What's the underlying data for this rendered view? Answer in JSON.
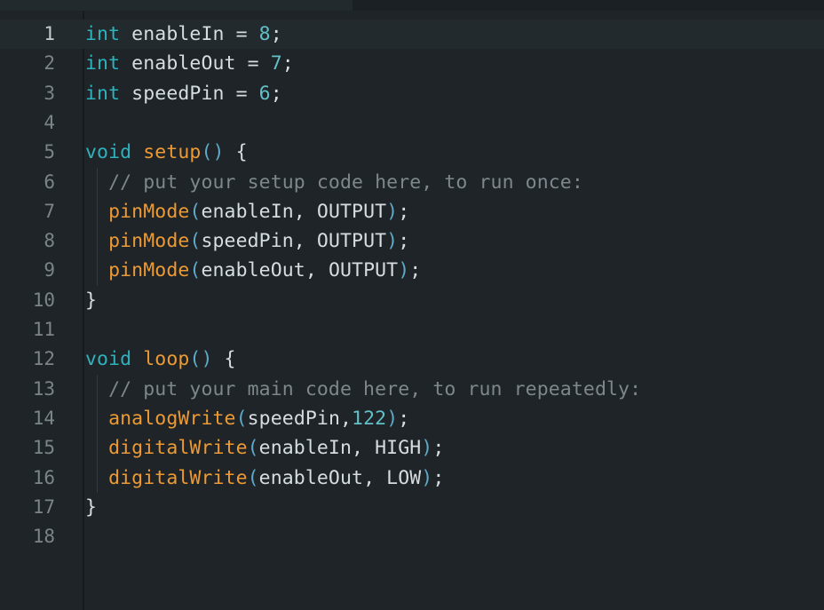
{
  "app": {
    "kind": "code-editor",
    "language": "arduino-c",
    "theme": "dark"
  },
  "colors": {
    "background": "#1e2427",
    "active_line_background": "#232a2d",
    "gutter_separator": "#161b1e",
    "top_strip_left": "#232a2d",
    "top_strip_right": "#1a2023",
    "line_number": "#7a8489",
    "line_number_active": "#c3ccd1",
    "keyword": "#2fb2bd",
    "function": "#ed9a34",
    "number": "#62c0c8",
    "comment": "#7d878c",
    "paren": "#5fa9c9",
    "plain_text": "#d6dde1",
    "indent_guide": "#333b40"
  },
  "editor": {
    "active_line": 1,
    "total_lines": 18,
    "line_numbers": [
      "1",
      "2",
      "3",
      "4",
      "5",
      "6",
      "7",
      "8",
      "9",
      "10",
      "11",
      "12",
      "13",
      "14",
      "15",
      "16",
      "17",
      "18"
    ],
    "lines": [
      {
        "number": "1",
        "plain": "int enableIn = 8;",
        "tokens": [
          {
            "t": "int",
            "c": "tok-keyword"
          },
          {
            "t": " enableIn = ",
            "c": "tok-plain"
          },
          {
            "t": "8",
            "c": "tok-number"
          },
          {
            "t": ";",
            "c": "tok-plain"
          }
        ]
      },
      {
        "number": "2",
        "plain": "int enableOut = 7;",
        "tokens": [
          {
            "t": "int",
            "c": "tok-keyword"
          },
          {
            "t": " enableOut = ",
            "c": "tok-plain"
          },
          {
            "t": "7",
            "c": "tok-number"
          },
          {
            "t": ";",
            "c": "tok-plain"
          }
        ]
      },
      {
        "number": "3",
        "plain": "int speedPin = 6;",
        "tokens": [
          {
            "t": "int",
            "c": "tok-keyword"
          },
          {
            "t": " speedPin = ",
            "c": "tok-plain"
          },
          {
            "t": "6",
            "c": "tok-number"
          },
          {
            "t": ";",
            "c": "tok-plain"
          }
        ]
      },
      {
        "number": "4",
        "plain": "",
        "tokens": []
      },
      {
        "number": "5",
        "plain": "void setup() {",
        "tokens": [
          {
            "t": "void",
            "c": "tok-keyword"
          },
          {
            "t": " ",
            "c": "tok-plain"
          },
          {
            "t": "setup",
            "c": "tok-function"
          },
          {
            "t": "()",
            "c": "tok-paren"
          },
          {
            "t": " {",
            "c": "tok-brace"
          }
        ]
      },
      {
        "number": "6",
        "plain": "  // put your setup code here, to run once:",
        "tokens": [
          {
            "t": "  // put your setup code here, to run once:",
            "c": "tok-comment"
          }
        ]
      },
      {
        "number": "7",
        "plain": "  pinMode(enableIn, OUTPUT);",
        "tokens": [
          {
            "t": "  ",
            "c": "tok-plain"
          },
          {
            "t": "pinMode",
            "c": "tok-function"
          },
          {
            "t": "(",
            "c": "tok-paren"
          },
          {
            "t": "enableIn, OUTPUT",
            "c": "tok-plain"
          },
          {
            "t": ")",
            "c": "tok-paren"
          },
          {
            "t": ";",
            "c": "tok-plain"
          }
        ]
      },
      {
        "number": "8",
        "plain": "  pinMode(speedPin, OUTPUT);",
        "tokens": [
          {
            "t": "  ",
            "c": "tok-plain"
          },
          {
            "t": "pinMode",
            "c": "tok-function"
          },
          {
            "t": "(",
            "c": "tok-paren"
          },
          {
            "t": "speedPin, OUTPUT",
            "c": "tok-plain"
          },
          {
            "t": ")",
            "c": "tok-paren"
          },
          {
            "t": ";",
            "c": "tok-plain"
          }
        ]
      },
      {
        "number": "9",
        "plain": "  pinMode(enableOut, OUTPUT);",
        "tokens": [
          {
            "t": "  ",
            "c": "tok-plain"
          },
          {
            "t": "pinMode",
            "c": "tok-function"
          },
          {
            "t": "(",
            "c": "tok-paren"
          },
          {
            "t": "enableOut, OUTPUT",
            "c": "tok-plain"
          },
          {
            "t": ")",
            "c": "tok-paren"
          },
          {
            "t": ";",
            "c": "tok-plain"
          }
        ]
      },
      {
        "number": "10",
        "plain": "}",
        "tokens": [
          {
            "t": "}",
            "c": "tok-brace"
          }
        ]
      },
      {
        "number": "11",
        "plain": "",
        "tokens": []
      },
      {
        "number": "12",
        "plain": "void loop() {",
        "tokens": [
          {
            "t": "void",
            "c": "tok-keyword"
          },
          {
            "t": " ",
            "c": "tok-plain"
          },
          {
            "t": "loop",
            "c": "tok-function"
          },
          {
            "t": "()",
            "c": "tok-paren"
          },
          {
            "t": " {",
            "c": "tok-brace"
          }
        ]
      },
      {
        "number": "13",
        "plain": "  // put your main code here, to run repeatedly:",
        "tokens": [
          {
            "t": "  // put your main code here, to run repeatedly:",
            "c": "tok-comment"
          }
        ]
      },
      {
        "number": "14",
        "plain": "  analogWrite(speedPin,122);",
        "tokens": [
          {
            "t": "  ",
            "c": "tok-plain"
          },
          {
            "t": "analogWrite",
            "c": "tok-function"
          },
          {
            "t": "(",
            "c": "tok-paren"
          },
          {
            "t": "speedPin,",
            "c": "tok-plain"
          },
          {
            "t": "122",
            "c": "tok-number"
          },
          {
            "t": ")",
            "c": "tok-paren"
          },
          {
            "t": ";",
            "c": "tok-plain"
          }
        ]
      },
      {
        "number": "15",
        "plain": "  digitalWrite(enableIn, HIGH);",
        "tokens": [
          {
            "t": "  ",
            "c": "tok-plain"
          },
          {
            "t": "digitalWrite",
            "c": "tok-function"
          },
          {
            "t": "(",
            "c": "tok-paren"
          },
          {
            "t": "enableIn, HIGH",
            "c": "tok-plain"
          },
          {
            "t": ")",
            "c": "tok-paren"
          },
          {
            "t": ";",
            "c": "tok-plain"
          }
        ]
      },
      {
        "number": "16",
        "plain": "  digitalWrite(enableOut, LOW);",
        "tokens": [
          {
            "t": "  ",
            "c": "tok-plain"
          },
          {
            "t": "digitalWrite",
            "c": "tok-function"
          },
          {
            "t": "(",
            "c": "tok-paren"
          },
          {
            "t": "enableOut, LOW",
            "c": "tok-plain"
          },
          {
            "t": ")",
            "c": "tok-paren"
          },
          {
            "t": ";",
            "c": "tok-plain"
          }
        ]
      },
      {
        "number": "17",
        "plain": "}",
        "tokens": [
          {
            "t": "}",
            "c": "tok-brace"
          }
        ]
      },
      {
        "number": "18",
        "plain": "",
        "tokens": []
      }
    ],
    "indent_guides": [
      {
        "from_line": 6,
        "to_line": 9
      },
      {
        "from_line": 13,
        "to_line": 16
      }
    ]
  }
}
